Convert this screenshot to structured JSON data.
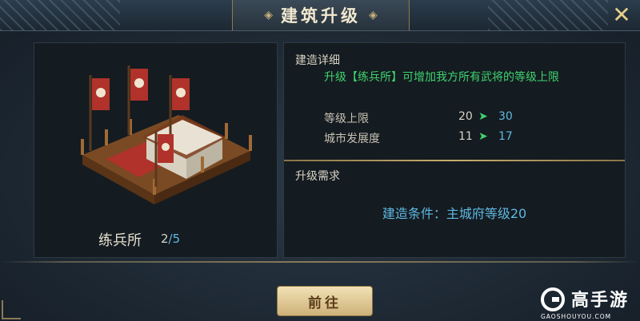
{
  "header": {
    "title": "建筑升级",
    "close_icon": "crossed-swords-icon"
  },
  "building": {
    "name": "练兵所",
    "count_current": "2",
    "count_max": "/5"
  },
  "details": {
    "section_title": "建造详细",
    "description": "升级【练兵所】可增加我方所有武将的等级上限",
    "stats": [
      {
        "label": "等级上限",
        "old": "20",
        "arrow": "➤",
        "new": "30"
      },
      {
        "label": "城市发展度",
        "old": "11",
        "arrow": "➤",
        "new": "17"
      }
    ]
  },
  "requirements": {
    "section_title": "升级需求",
    "condition": "建造条件：主城府等级20"
  },
  "footer": {
    "go_button": "前往"
  },
  "watermark": {
    "text": "高手游",
    "sub": "GAOSHOUYOU.COM"
  },
  "colors": {
    "highlight_green": "#3fd46e",
    "highlight_blue": "#5fb8e0",
    "gold": "#c9ad6c"
  }
}
